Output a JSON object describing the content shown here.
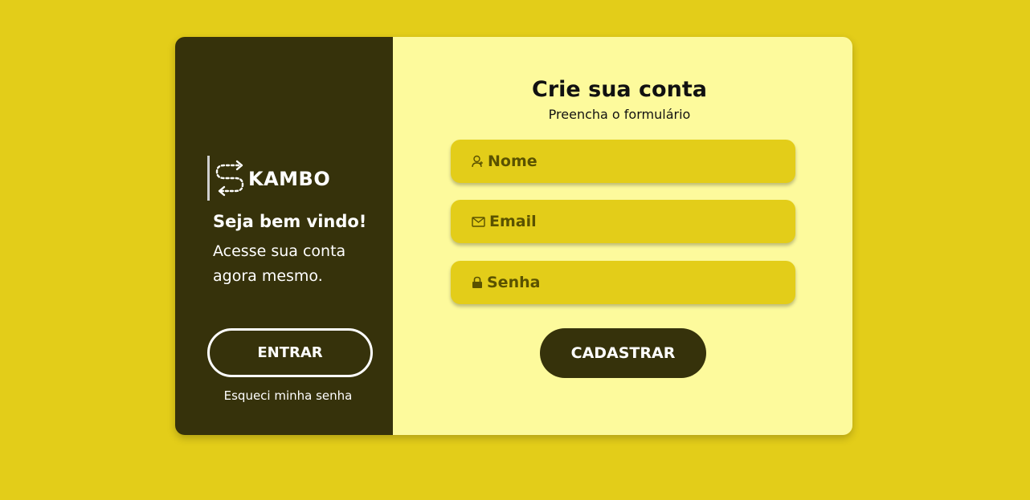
{
  "brand": {
    "logo_text": "KAMBO",
    "logo_icon": "s-arrows-logo-icon"
  },
  "welcome": {
    "title": "Seja bem vindo!",
    "subtitle": "Acesse sua conta agora mesmo."
  },
  "login": {
    "enter_label": "ENTRAR",
    "forgot_label": "Esqueci minha senha"
  },
  "signup": {
    "title": "Crie sua conta",
    "subtitle": "Preencha o formulário",
    "fields": [
      {
        "placeholder": "Nome",
        "value": "",
        "icon": "user-icon"
      },
      {
        "placeholder": "Email",
        "value": "",
        "icon": "mail-icon"
      },
      {
        "placeholder": "Senha",
        "value": "",
        "icon": "lock-icon"
      }
    ],
    "submit_label": "CADASTRAR"
  },
  "colors": {
    "background": "#e3cd19",
    "panel_dark": "#36320b",
    "panel_light": "#fdfa9c",
    "input_bg": "#e3cd19",
    "input_text": "#5a5200"
  }
}
